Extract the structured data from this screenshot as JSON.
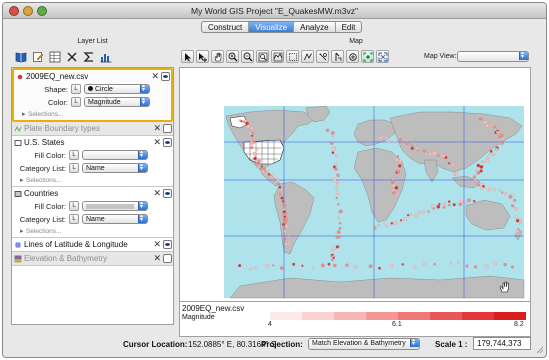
{
  "window": {
    "title": "My World GIS Project \"E_QuakesMW.m3vz\""
  },
  "mode_tabs": [
    {
      "label": "Construct",
      "active": false
    },
    {
      "label": "Visualize",
      "active": true
    },
    {
      "label": "Analyze",
      "active": false
    },
    {
      "label": "Edit",
      "active": false
    }
  ],
  "layer_panel": {
    "title": "Layer List",
    "tools": [
      "book-icon",
      "edit-icon",
      "grid-icon",
      "delete-icon",
      "sigma-icon",
      "histogram-icon"
    ],
    "layers": [
      {
        "name": "2009EQ_new.csv",
        "selected": true,
        "props": [
          {
            "label": "Shape:",
            "value": "Circle",
            "lock_glyph": "L"
          },
          {
            "label": "Color:",
            "value": "Magnitude",
            "lock_glyph": "L"
          }
        ],
        "selections": "Selections..."
      },
      {
        "name": "Plate Boundary types",
        "dim": true
      },
      {
        "name": "U.S. States",
        "props": [
          {
            "label": "Fill Color:",
            "value": "",
            "lock_glyph": "L"
          },
          {
            "label": "Category List:",
            "value": "Name",
            "lock_glyph": "L"
          }
        ],
        "selections": "Selections..."
      },
      {
        "name": "Countries",
        "props": [
          {
            "label": "Fill Color:",
            "value": "",
            "lock_glyph": "L"
          },
          {
            "label": "Category List:",
            "value": "Name",
            "lock_glyph": "L"
          }
        ],
        "selections": "Selections..."
      },
      {
        "name": "Lines of Latitude & Longitude"
      },
      {
        "name": "Elevation & Bathymetry",
        "dim": true
      }
    ]
  },
  "map_panel": {
    "title": "Map",
    "map_view_label": "Map View:",
    "map_view_value": "",
    "tools": [
      "arrow-icon",
      "arrow-plus-icon",
      "hand-icon",
      "zoom-in-icon",
      "zoom-out-icon",
      "layer-zoom-icon",
      "region-zoom-icon",
      "lasso-icon",
      "polyline-icon",
      "label-icon",
      "measure-icon",
      "buffer-icon",
      "fit-icon",
      "expand-icon"
    ]
  },
  "legend": {
    "layer_name": "2009EQ_new.csv",
    "field": "Magnitude",
    "ticks": [
      "4",
      "6.1",
      "8.2"
    ],
    "colors": [
      "#fde9e9",
      "#fbd1d1",
      "#f8b5b5",
      "#f49797",
      "#ef7878",
      "#e95656",
      "#e23838",
      "#d91e1e"
    ]
  },
  "status": {
    "cursor_label": "Cursor Location:",
    "cursor_value": "152.0885° E, 80.3164° S",
    "projection_label": "Projection:",
    "projection_value": "Match Elevation & Bathymetry",
    "scale_label": "Scale 1 :",
    "scale_value": "179,744,373"
  },
  "colors": {
    "ocean": "#aee3ec",
    "land": "#bdbdbd",
    "us_states": "#ffffff",
    "grid": "#2b4fd8",
    "quakes": "#e88a8a",
    "selection": "#e7b10a"
  }
}
